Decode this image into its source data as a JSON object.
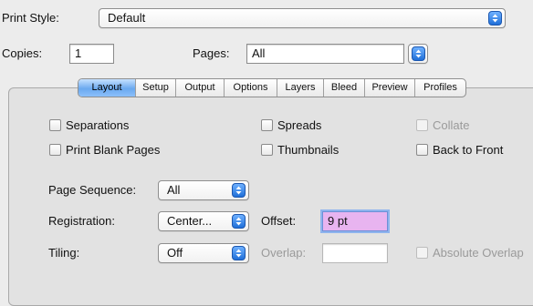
{
  "print_style": {
    "label": "Print Style:",
    "value": "Default"
  },
  "copies": {
    "label": "Copies:",
    "value": "1"
  },
  "pages": {
    "label": "Pages:",
    "value": "All"
  },
  "tabs": [
    {
      "label": "Layout",
      "active": true
    },
    {
      "label": "Setup",
      "active": false
    },
    {
      "label": "Output",
      "active": false
    },
    {
      "label": "Options",
      "active": false
    },
    {
      "label": "Layers",
      "active": false
    },
    {
      "label": "Bleed",
      "active": false
    },
    {
      "label": "Preview",
      "active": false
    },
    {
      "label": "Profiles",
      "active": false
    }
  ],
  "checkboxes": {
    "separations": {
      "label": "Separations",
      "checked": false,
      "enabled": true
    },
    "spreads": {
      "label": "Spreads",
      "checked": false,
      "enabled": true
    },
    "collate": {
      "label": "Collate",
      "checked": false,
      "enabled": false
    },
    "print_blank_pages": {
      "label": "Print Blank Pages",
      "checked": false,
      "enabled": true
    },
    "thumbnails": {
      "label": "Thumbnails",
      "checked": false,
      "enabled": true
    },
    "back_to_front": {
      "label": "Back to Front",
      "checked": false,
      "enabled": true
    },
    "absolute_overlap": {
      "label": "Absolute Overlap",
      "checked": false,
      "enabled": false
    }
  },
  "page_sequence": {
    "label": "Page Sequence:",
    "value": "All"
  },
  "registration": {
    "label": "Registration:",
    "value": "Center..."
  },
  "offset": {
    "label": "Offset:",
    "value": "9 pt"
  },
  "tiling": {
    "label": "Tiling:",
    "value": "Off"
  },
  "overlap": {
    "label": "Overlap:",
    "value": ""
  },
  "colors": {
    "accent": "#3d86e8",
    "highlight_field": "#e8b4f0"
  }
}
